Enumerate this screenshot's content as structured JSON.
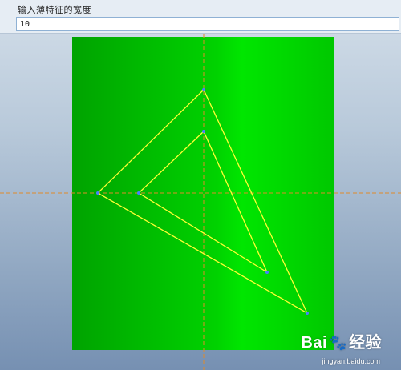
{
  "prompt": {
    "label": "输入薄特征的宽度",
    "value": "10"
  },
  "colors": {
    "part_green_dark": "#00aa00",
    "part_green_light": "#00e400",
    "sketch_yellow": "#ffff33",
    "centerline_orange": "#e08a2a",
    "vertex_blue": "#4a80ff"
  },
  "watermark": {
    "logo_text": "Bai",
    "logo_icon": "paw-icon",
    "logo_suffix": "经验",
    "url": "jingyan.baidu.com"
  }
}
